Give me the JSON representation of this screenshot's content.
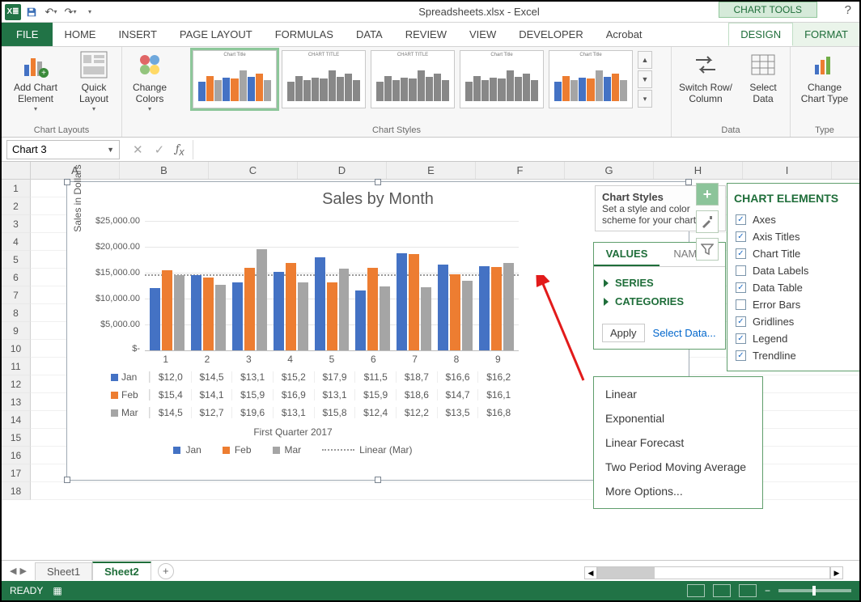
{
  "app": {
    "title_full": "Spreadsheets.xlsx - Excel",
    "chart_tools": "CHART TOOLS",
    "help": "?"
  },
  "tabs": {
    "file": "FILE",
    "list": [
      "HOME",
      "INSERT",
      "PAGE LAYOUT",
      "FORMULAS",
      "DATA",
      "REVIEW",
      "VIEW",
      "DEVELOPER",
      "Acrobat"
    ],
    "ctx_design": "DESIGN",
    "ctx_format": "FORMAT"
  },
  "ribbon": {
    "add_chart_element": "Add Chart Element",
    "quick_layout": "Quick Layout",
    "change_colors": "Change Colors",
    "group_layouts": "Chart Layouts",
    "group_styles": "Chart Styles",
    "switch": "Switch Row/ Column",
    "select_data": "Select Data",
    "group_data": "Data",
    "change_type": "Change Chart Type",
    "group_type": "Type"
  },
  "namebox": "Chart 3",
  "cols": [
    "A",
    "B",
    "C",
    "D",
    "E",
    "F",
    "G",
    "H",
    "I"
  ],
  "rows": [
    "1",
    "2",
    "3",
    "4",
    "5",
    "6",
    "7",
    "8",
    "9",
    "10",
    "11",
    "12",
    "13",
    "14",
    "15",
    "16",
    "17",
    "18"
  ],
  "chart": {
    "title": "Sales by Month",
    "y_axis": "Sales in Dollars",
    "x_axis": "First Quarter 2017",
    "yticks": [
      "$25,000.00",
      "$20,000.00",
      "$15,000.00",
      "$10,000.00",
      "$5,000.00",
      "$-"
    ],
    "xcats": [
      "1",
      "2",
      "3",
      "4",
      "5",
      "6",
      "7",
      "8",
      "9"
    ],
    "series": [
      {
        "name": "Jan",
        "color": "#4472c4",
        "vals": [
          "$12,0",
          "$14,5",
          "$13,1",
          "$15,2",
          "$17,9",
          "$11,5",
          "$18,7",
          "$16,6",
          "$16,2"
        ]
      },
      {
        "name": "Feb",
        "color": "#ed7d31",
        "vals": [
          "$15,4",
          "$14,1",
          "$15,9",
          "$16,9",
          "$13,1",
          "$15,9",
          "$18,6",
          "$14,7",
          "$16,1"
        ]
      },
      {
        "name": "Mar",
        "color": "#a5a5a5",
        "vals": [
          "$14,5",
          "$12,7",
          "$19,6",
          "$13,1",
          "$15,8",
          "$12,4",
          "$12,2",
          "$13,5",
          "$16,8"
        ]
      }
    ],
    "legend_trend": "Linear (Mar)"
  },
  "chart_data": {
    "type": "bar",
    "title": "Sales by Month",
    "xlabel": "First Quarter 2017",
    "ylabel": "Sales in Dollars",
    "ylim": [
      0,
      25000
    ],
    "categories": [
      "1",
      "2",
      "3",
      "4",
      "5",
      "6",
      "7",
      "8",
      "9"
    ],
    "series": [
      {
        "name": "Jan",
        "values": [
          12000,
          14500,
          13100,
          15200,
          17900,
          11500,
          18700,
          16600,
          16200
        ]
      },
      {
        "name": "Feb",
        "values": [
          15400,
          14100,
          15900,
          16900,
          13100,
          15900,
          18600,
          14700,
          16100
        ]
      },
      {
        "name": "Mar",
        "values": [
          14500,
          12700,
          19600,
          13100,
          15800,
          12400,
          12200,
          13500,
          16800
        ]
      }
    ],
    "trendline": {
      "series": "Mar",
      "type": "Linear"
    }
  },
  "cs_tip": {
    "title": "Chart Styles",
    "body": "Set a style and color scheme for your chart."
  },
  "values_panel": {
    "tabs": {
      "values": "VALUES",
      "names": "NAMES"
    },
    "series": "SERIES",
    "categories": "CATEGORIES",
    "apply": "Apply",
    "select_data": "Select Data..."
  },
  "elements": {
    "title": "CHART ELEMENTS",
    "items": [
      {
        "label": "Axes",
        "checked": true
      },
      {
        "label": "Axis Titles",
        "checked": true
      },
      {
        "label": "Chart Title",
        "checked": true
      },
      {
        "label": "Data Labels",
        "checked": false
      },
      {
        "label": "Data Table",
        "checked": true
      },
      {
        "label": "Error Bars",
        "checked": false
      },
      {
        "label": "Gridlines",
        "checked": true
      },
      {
        "label": "Legend",
        "checked": true
      },
      {
        "label": "Trendline",
        "checked": true,
        "flyout": true
      }
    ]
  },
  "trend_menu": [
    "Linear",
    "Exponential",
    "Linear Forecast",
    "Two Period Moving Average",
    "More Options..."
  ],
  "sheets": {
    "s1": "Sheet1",
    "s2": "Sheet2"
  },
  "status": {
    "ready": "READY"
  }
}
